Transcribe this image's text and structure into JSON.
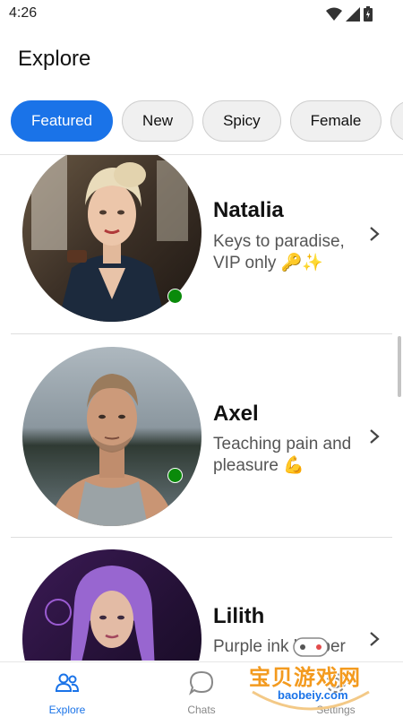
{
  "status_bar": {
    "time": "4:26"
  },
  "header": {
    "title": "Explore"
  },
  "filters": [
    {
      "label": "Featured",
      "active": true
    },
    {
      "label": "New",
      "active": false
    },
    {
      "label": "Spicy",
      "active": false
    },
    {
      "label": "Female",
      "active": false
    }
  ],
  "characters": [
    {
      "name": "Natalia",
      "tagline": "Keys to paradise, VIP only 🔑✨",
      "online": true
    },
    {
      "name": "Axel",
      "tagline": "Teaching pain and pleasure 💪",
      "online": true
    },
    {
      "name": "Lilith",
      "tagline": "Purple ink keeper",
      "online": false
    }
  ],
  "bottom_nav": [
    {
      "label": "Explore",
      "icon": "people-icon",
      "active": true
    },
    {
      "label": "Chats",
      "icon": "chat-bubble-icon",
      "active": false
    },
    {
      "label": "Settings",
      "icon": "gear-icon",
      "active": false
    }
  ],
  "watermark": {
    "text": "宝贝游戏网",
    "sub": "baobeiy.com"
  },
  "colors": {
    "accent": "#1a73e8",
    "online": "#0a8a0a",
    "watermark": "#f39a1e"
  }
}
